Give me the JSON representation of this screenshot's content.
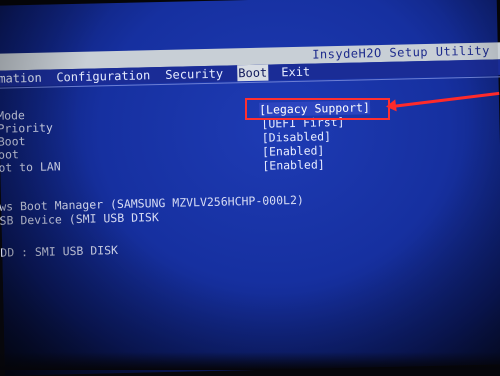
{
  "window": {
    "title": "InsydeH2O Setup Utility"
  },
  "menu": {
    "items": [
      {
        "label": "mation"
      },
      {
        "label": "Configuration"
      },
      {
        "label": "Security"
      },
      {
        "label": "Boot"
      },
      {
        "label": "Exit"
      }
    ],
    "active_index": 3
  },
  "settings": [
    {
      "label": "Mode",
      "value": "[Legacy Support]"
    },
    {
      "label": "Priority",
      "value": "[UEFI First]"
    },
    {
      "label": "Boot",
      "value": "[Disabled]"
    },
    {
      "label": "oot",
      "value": "[Enabled]"
    },
    {
      "label": "ot to LAN",
      "value": "[Enabled]"
    }
  ],
  "boot_devices": [
    {
      "label": "ws Boot Manager (SAMSUNG MZVLV256HCHP-000L2)"
    },
    {
      "label": "SB Device (SMI      USB DISK"
    },
    {
      "label": "DD    : SMI      USB DISK"
    }
  ],
  "colors": {
    "screen_blue": "#1630a0",
    "title_bar": "#c8cfd6",
    "annotation_red": "#ff3030"
  }
}
